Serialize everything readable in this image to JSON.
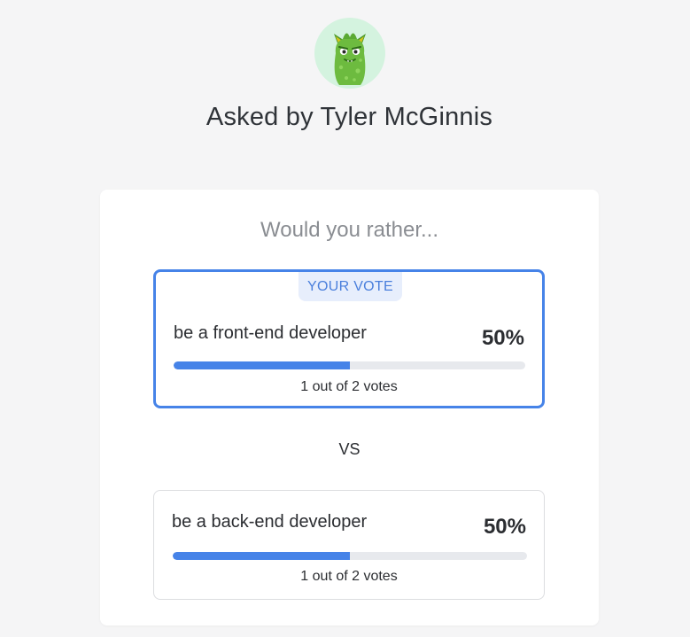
{
  "author": {
    "avatar_icon": "green-monster-avatar",
    "asked_by_label": "Asked by Tyler McGinnis"
  },
  "poll": {
    "question": "Would you rather...",
    "vs_label": "VS",
    "accent_color": "#4683e8",
    "options": [
      {
        "text": "be a front-end developer",
        "percent_label": "50%",
        "percent": 50,
        "votes_label": "1 out of 2 votes",
        "is_user_vote": true,
        "badge_label": "YOUR VOTE"
      },
      {
        "text": "be a back-end developer",
        "percent_label": "50%",
        "percent": 50,
        "votes_label": "1 out of 2 votes",
        "is_user_vote": false
      }
    ]
  }
}
